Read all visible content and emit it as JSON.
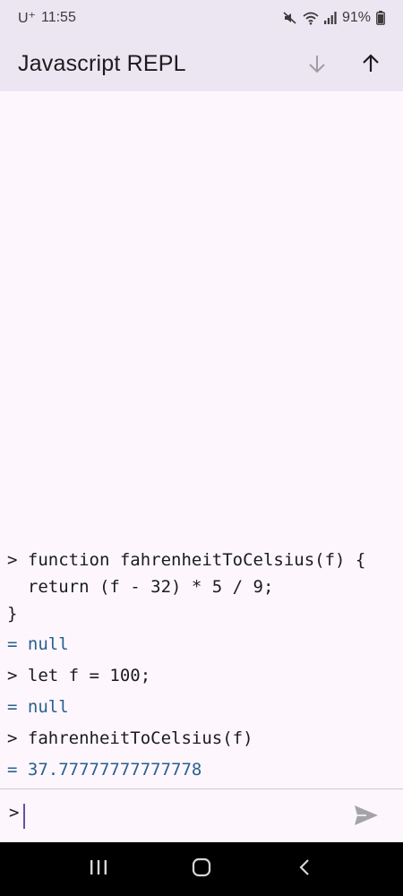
{
  "status_bar": {
    "carrier": "U⁺",
    "time": "11:55",
    "battery": "91%",
    "icons": [
      "mute-icon",
      "wifi-icon",
      "signal-icon",
      "battery-icon"
    ]
  },
  "app_bar": {
    "title": "Javascript REPL",
    "actions": [
      "arrow-down-icon",
      "arrow-up-icon"
    ]
  },
  "console": {
    "lines": [
      {
        "kind": "input",
        "text": "> function fahrenheitToCelsius(f) {"
      },
      {
        "kind": "input",
        "text": "  return (f - 32) * 5 / 9;"
      },
      {
        "kind": "input",
        "text": "}"
      },
      {
        "kind": "result",
        "text": "= null"
      },
      {
        "kind": "input",
        "text": "> let f = 100;"
      },
      {
        "kind": "result",
        "text": "= null"
      },
      {
        "kind": "input",
        "text": "> fahrenheitToCelsius(f)"
      },
      {
        "kind": "result",
        "text": "= 37.77777777777778"
      }
    ]
  },
  "input_bar": {
    "prompt": ">",
    "value": "",
    "send_icon": "send-icon"
  },
  "nav_bar": {
    "buttons": [
      "recents-icon",
      "home-icon",
      "back-icon"
    ]
  },
  "colors": {
    "app_bar_bg": "#ece6f3",
    "page_bg": "#fdf7fd",
    "result_text": "#2a5f8f",
    "icon_disabled": "#9e9ea3"
  }
}
